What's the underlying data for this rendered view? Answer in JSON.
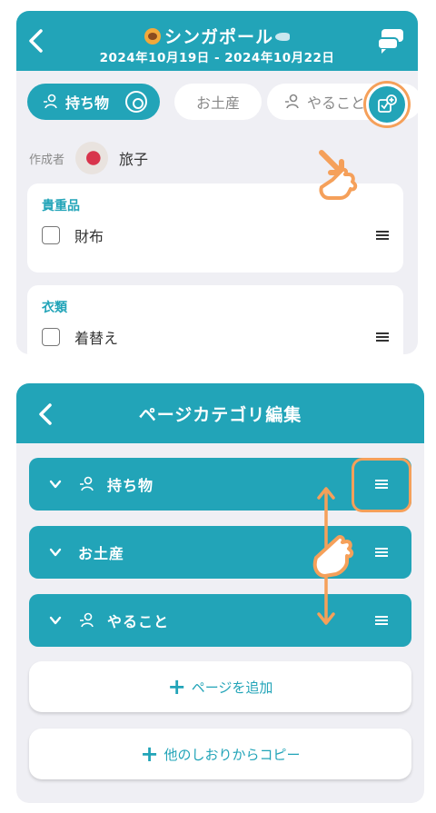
{
  "panel1": {
    "header": {
      "title": "シンガポール",
      "dates": "2024年10月19日 - 2024年10月22日"
    },
    "tabs": [
      {
        "label": "持ち物",
        "active": true
      },
      {
        "label": "お土産",
        "active": false
      },
      {
        "label": "やること",
        "active": false
      }
    ],
    "author": {
      "label": "作成者",
      "name": "旅子"
    },
    "cards": [
      {
        "title": "貴重品",
        "items": [
          "財布"
        ]
      },
      {
        "title": "衣類",
        "items": [
          "着替え"
        ]
      }
    ]
  },
  "panel2": {
    "header": {
      "title": "ページカテゴリ編集"
    },
    "categories": [
      {
        "label": "持ち物",
        "has_person_icon": true
      },
      {
        "label": "お土産",
        "has_person_icon": false
      },
      {
        "label": "やること",
        "has_person_icon": true
      }
    ],
    "buttons": {
      "add_page": "ページを追加",
      "copy_from_other": "他のしおりからコピー"
    }
  },
  "colors": {
    "accent": "#22a4b8",
    "highlight": "#f5a05a",
    "background": "#efeff4"
  },
  "icons": [
    "back-arrow-icon",
    "chat-icon",
    "person-icon",
    "gear-icon",
    "add-page-icon",
    "chevron-down-icon",
    "drag-handle-icon",
    "pointer-hand-icon"
  ]
}
